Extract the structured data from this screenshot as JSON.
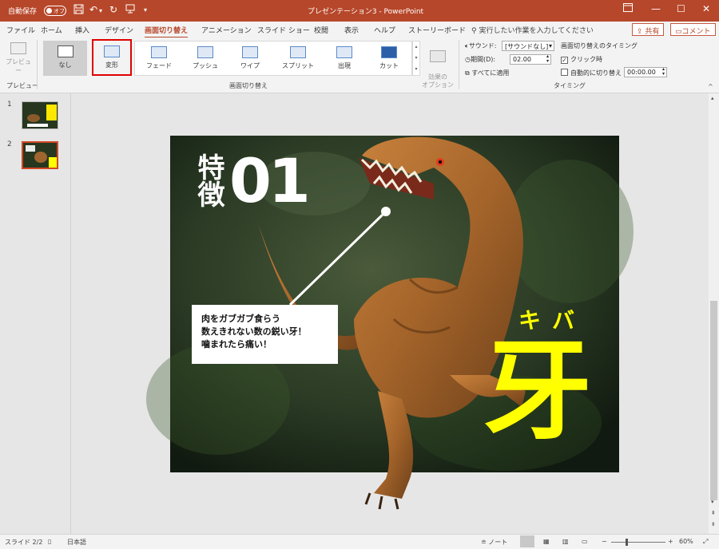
{
  "titlebar": {
    "autosave_label": "自動保存",
    "autosave_state": "オフ",
    "document_title": "プレゼンテーション3 - PowerPoint",
    "qat_icons": [
      "save-icon",
      "undo-icon",
      "redo-icon",
      "start-from-beginning-icon",
      "customize-qat-icon"
    ],
    "window_buttons": [
      "ribbon-display-options-icon",
      "minimize-icon",
      "maximize-icon",
      "close-icon"
    ]
  },
  "tabs": [
    "ファイル",
    "ホーム",
    "挿入",
    "デザイン",
    "画面切り替え",
    "アニメーション",
    "スライド ショー",
    "校閲",
    "表示",
    "ヘルプ",
    "ストーリーボード"
  ],
  "active_tab": "画面切り替え",
  "tell_me": "実行したい作業を入力してください",
  "share_label": "共有",
  "comment_label": "コメント",
  "ribbon": {
    "preview": {
      "button": "プレビュー",
      "group": "プレビュー"
    },
    "transitions": {
      "group": "画面切り替え",
      "none": "なし",
      "morph": "変形",
      "gallery": [
        "フェード",
        "プッシュ",
        "ワイプ",
        "スプリット",
        "出現",
        "カット"
      ],
      "effect_options": "効果の\nオプション"
    },
    "timing": {
      "group": "タイミング",
      "sound_label": "サウンド:",
      "sound_value": "[サウンドなし]",
      "duration_label": "期間(D):",
      "duration_value": "02.00",
      "apply_all": "すべてに適用",
      "advance_title": "画面切り替えのタイミング",
      "on_click": "クリック時",
      "on_click_checked": true,
      "after_label": "自動的に切り替え",
      "after_checked": false,
      "after_value": "00:00.00"
    }
  },
  "thumbnails": [
    {
      "number": "1",
      "selected": false
    },
    {
      "number": "2",
      "selected": true
    }
  ],
  "slide": {
    "feature_kanji": "特徴",
    "feature_number": "01",
    "callout": [
      "肉をガブガブ食らう",
      "数えきれない数の鋭い牙！",
      "噛まれたら痛い！"
    ],
    "ruby": "キバ",
    "big_kanji": "牙",
    "highlight_color": "#ffff00"
  },
  "status": {
    "slide_label": "スライド 2/2",
    "language": "日本語",
    "notes": "ノート",
    "zoom": "60%",
    "view_icons": [
      "normal-view-icon",
      "slide-sorter-icon",
      "reading-view-icon",
      "slide-show-icon"
    ]
  },
  "colors": {
    "accent": "#b7472a",
    "highlight_box": "#e00000"
  }
}
